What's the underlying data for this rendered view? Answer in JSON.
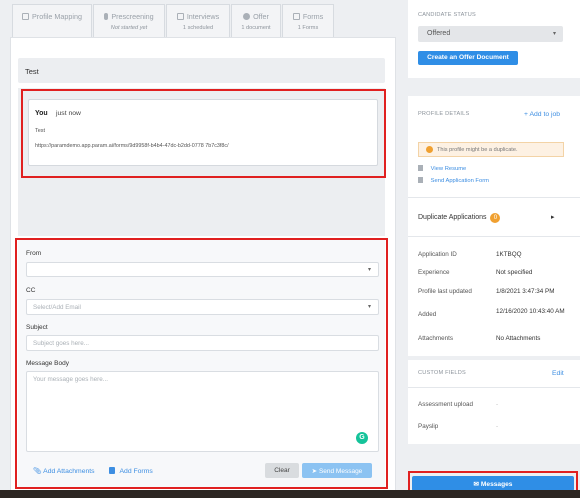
{
  "tabs": [
    {
      "label": "Profile Mapping",
      "sub": ""
    },
    {
      "label": "Prescreening",
      "sub": "Not started yet"
    },
    {
      "label": "Interviews",
      "sub": "1 scheduled"
    },
    {
      "label": "Offer",
      "sub": "1 document"
    },
    {
      "label": "Forms",
      "sub": "1 Forms"
    }
  ],
  "thread": {
    "title": "Test",
    "message": {
      "author": "You",
      "time": "just now",
      "subject": "Test",
      "link": "https://paramdemo.app.param.ai/forms/9d9958f-b4b4-47dc-b2dd-0778 7b7c3f8c/"
    }
  },
  "compose": {
    "from_label": "From",
    "from_value": "",
    "cc_label": "CC",
    "cc_placeholder": "Select/Add Email",
    "subject_label": "Subject",
    "subject_placeholder": "Subject goes here...",
    "body_label": "Message Body",
    "body_placeholder": "Your message goes here...",
    "grammarly_letter": "G",
    "add_attachments": "Add Attachments",
    "add_forms": "Add Forms",
    "clear": "Clear",
    "send": "Send Message"
  },
  "sidebar": {
    "candidate_status_heading": "CANDIDATE STATUS",
    "status_value": "Offered",
    "create_offer": "Create an Offer Document",
    "profile_details_heading": "PROFILE DETAILS",
    "add_to_job": "+ Add to job",
    "duplicate_warning": "This profile might be a duplicate.",
    "view_resume": "View Resume",
    "send_application_form": "Send Application Form",
    "duplicate_applications": "Duplicate Applications",
    "duplicate_count": "0",
    "details": [
      {
        "key": "Application ID",
        "value": "1KTBQQ"
      },
      {
        "key": "Experience",
        "value": "Not specified"
      },
      {
        "key": "Profile last updated",
        "value": "1/8/2021 3:47:34 PM"
      },
      {
        "key": "Added",
        "value": "12/16/2020 10:43:40 AM"
      },
      {
        "key": "Attachments",
        "value": "No Attachments"
      }
    ],
    "custom_fields_heading": "CUSTOM FIELDS",
    "edit": "Edit",
    "custom_fields": [
      {
        "key": "Assessment upload",
        "value": "-"
      },
      {
        "key": "Payslip",
        "value": "-"
      }
    ],
    "messages_button": "Messages"
  },
  "colors": {
    "accent": "#2f8ee6",
    "highlight": "#e02020",
    "warning": "#f0a030"
  }
}
